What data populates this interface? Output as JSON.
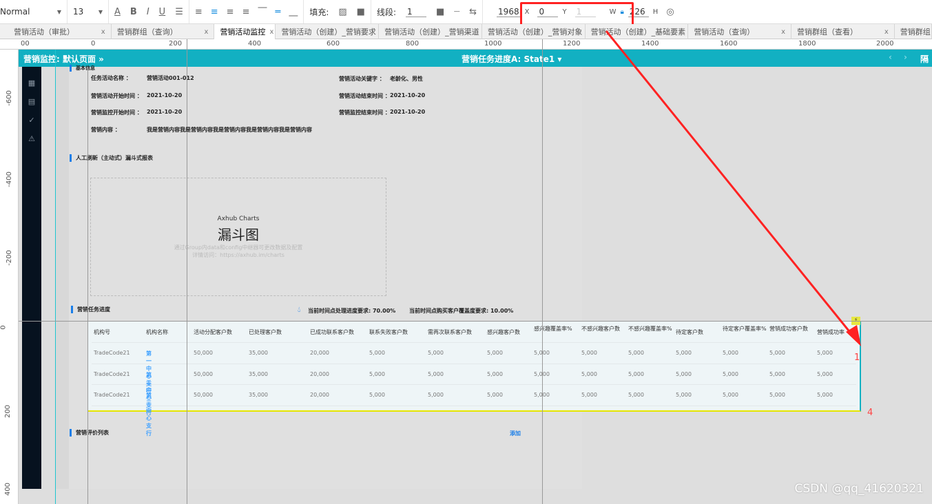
{
  "toolbar": {
    "style": "Normal",
    "font_size": "13",
    "fill_label": "填充:",
    "line_label": "线段:",
    "line_width": "1",
    "x": "1968",
    "x_label": "X",
    "y": "0",
    "y_label": "Y",
    "y_placeholder": "1",
    "w_label": "W",
    "w": "226",
    "h_label": "H"
  },
  "tabs": [
    {
      "label": "营销活动（审批）",
      "close": "x"
    },
    {
      "label": "营销群组（查询）",
      "close": "x"
    },
    {
      "label": "营销活动监控",
      "close": "x",
      "active": true
    },
    {
      "label": "营销活动（创建）_营销要求",
      "close": "x"
    },
    {
      "label": "营销活动（创建）_营销渠道",
      "close": "x"
    },
    {
      "label": "营销活动（创建）_营销对象",
      "close": "x"
    },
    {
      "label": "营销活动（创建）_基础要素",
      "close": "x"
    },
    {
      "label": "营销活动（查询）",
      "close": "x"
    },
    {
      "label": "营销群组（查看）",
      "close": "x"
    },
    {
      "label": "营销群组",
      "close": ""
    }
  ],
  "hruler": [
    "00",
    "0",
    "200",
    "400",
    "600",
    "800",
    "1000",
    "1200",
    "1400",
    "1600",
    "1800",
    "2000"
  ],
  "vruler": [
    "-600",
    "-400",
    "-200",
    "0",
    "200",
    "400"
  ],
  "topbar": {
    "page": "营销监控: 默认页面 »",
    "state": "营销任务进度A: State1 ▾",
    "prev": "‹",
    "next": "›",
    "right": "隔"
  },
  "sidebar": {
    "icons": [
      "table-icon",
      "list-icon",
      "check-circle-icon",
      "warning-icon"
    ]
  },
  "basic": {
    "section": "基本信息",
    "fields": [
      {
        "label": "任务活动名称 ：",
        "value": "营销活动001-012"
      },
      {
        "label": "营销活动关键字 ：",
        "value": "老龄化、男性"
      },
      {
        "label": "营销活动开始时间 ：",
        "value": "2021-10-20"
      },
      {
        "label": "营销活动结束时间 ：",
        "value": "2021-10-20"
      },
      {
        "label": "营销监控开始时间 ：",
        "value": "2021-10-20"
      },
      {
        "label": "营销监控结束时间 ：",
        "value": "2021-10-20"
      },
      {
        "label": "营销内容 ：",
        "value": "我是营销内容我是营销内容我是营销内容我是营销内容我是营销内容"
      }
    ]
  },
  "funnel": {
    "section": "人工刷新（主动式）漏斗式报表",
    "brand": "Axhub Charts",
    "title": "漏斗图",
    "hint": "通过Group内data和config中继器可更改数据及配置",
    "link": "详情访问：https://axhub.im/charts"
  },
  "progress": {
    "section": "营销任务进度",
    "req1": "当前时间点处理进度要求:  70.00%",
    "req2": "当前时间点购买客户覆盖度要求:  10.00%"
  },
  "table": {
    "headers": [
      "机构号",
      "机构名称",
      "活动分配客户数",
      "已处理客户数",
      "已成功联系客户数",
      "联系失败客户数",
      "需再次联系客户数",
      "感兴趣客户数",
      "感兴趣覆盖率%",
      "不感兴趣客户数",
      "不感兴趣覆盖率%",
      "待定客户数",
      "待定客户覆盖率%",
      "营销成功客户数",
      "营销成功率"
    ],
    "rows": [
      [
        "TradeCode21",
        "第一中心支行",
        "50,000",
        "35,000",
        "20,000",
        "5,000",
        "5,000",
        "5,000",
        "5,000",
        "5,000",
        "5,000",
        "5,000",
        "5,000",
        "5,000",
        "5,000"
      ],
      [
        "TradeCode21",
        "第二中心支行",
        "50,000",
        "35,000",
        "20,000",
        "5,000",
        "5,000",
        "5,000",
        "5,000",
        "5,000",
        "5,000",
        "5,000",
        "5,000",
        "5,000",
        "5,000"
      ],
      [
        "TradeCode21",
        "第三中心支行",
        "50,000",
        "35,000",
        "20,000",
        "5,000",
        "5,000",
        "5,000",
        "5,000",
        "5,000",
        "5,000",
        "5,000",
        "5,000",
        "5,000",
        "5,000"
      ]
    ]
  },
  "eval": {
    "section": "营销评价列表",
    "add": "添加"
  },
  "annotations": {
    "a1": "1",
    "a4": "4"
  },
  "watermark": "CSDN @qq_41620321",
  "colors": {
    "accent": "#12b0c2",
    "sidebar": "#06121f",
    "link": "#3fa1ff",
    "annotation": "#ff2222"
  }
}
